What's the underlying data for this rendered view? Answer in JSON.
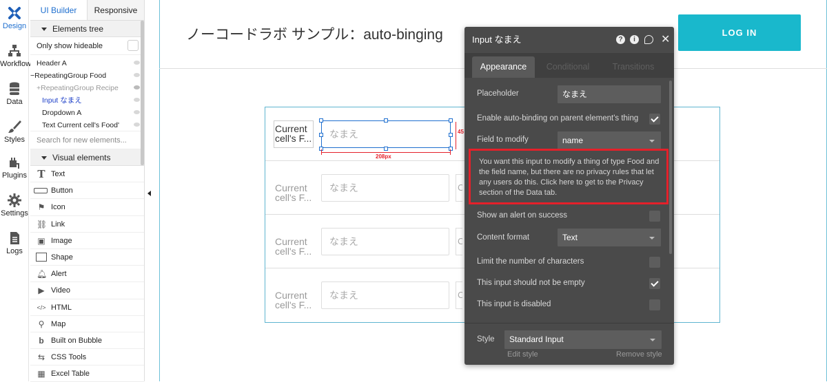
{
  "nav": [
    {
      "label": "Design",
      "icon": "design-icon",
      "active": true
    },
    {
      "label": "Workflow",
      "icon": "workflow-icon"
    },
    {
      "label": "Data",
      "icon": "data-icon"
    },
    {
      "label": "Styles",
      "icon": "styles-icon"
    },
    {
      "label": "Plugins",
      "icon": "plugins-icon"
    },
    {
      "label": "Settings",
      "icon": "settings-icon"
    },
    {
      "label": "Logs",
      "icon": "logs-icon"
    }
  ],
  "panel": {
    "tab_ui_builder": "UI Builder",
    "tab_responsive": "Responsive",
    "elements_tree": "Elements tree",
    "only_show_hideable": "Only show hideable",
    "tree": [
      {
        "label": "Header A"
      },
      {
        "label": "RepeatingGroup Food",
        "prefix": "−"
      },
      {
        "label": "RepeatingGroup Recipe",
        "prefix": "+"
      },
      {
        "label": "Input なまえ"
      },
      {
        "label": "Dropdown A"
      },
      {
        "label": "Text Current cell's Food'"
      }
    ],
    "search_placeholder": "Search for new elements...",
    "visual_elements": "Visual elements",
    "visual_items": [
      {
        "label": "Text",
        "icon": "text-icon"
      },
      {
        "label": "Button",
        "icon": "button-icon"
      },
      {
        "label": "Icon",
        "icon": "icon-icon"
      },
      {
        "label": "Link",
        "icon": "link-icon"
      },
      {
        "label": "Image",
        "icon": "image-icon"
      },
      {
        "label": "Shape",
        "icon": "shape-icon"
      },
      {
        "label": "Alert",
        "icon": "alert-icon"
      },
      {
        "label": "Video",
        "icon": "video-icon"
      },
      {
        "label": "HTML",
        "icon": "html-icon"
      },
      {
        "label": "Map",
        "icon": "map-icon"
      },
      {
        "label": "Built on Bubble",
        "icon": "bubble-icon"
      },
      {
        "label": "CSS Tools",
        "icon": "css-tools-icon"
      },
      {
        "label": "Excel Table",
        "icon": "excel-icon"
      }
    ]
  },
  "canvas": {
    "title": "ノーコードラボ サンプル：auto-binging",
    "login": "LOG IN",
    "cell_text": "Current cell's F...",
    "cell_text_line1": "Current",
    "cell_text_line2": "cell's F...",
    "input_placeholder": "なまえ",
    "cut_char": "C",
    "width_label": "208px",
    "offset_label": "45"
  },
  "editor": {
    "title": "Input なまえ",
    "tabs": [
      "Appearance",
      "Conditional",
      "Transitions"
    ],
    "placeholder_label": "Placeholder",
    "placeholder_value": "なまえ",
    "auto_binding_label": "Enable auto-binding on parent element's thing",
    "field_label": "Field to modify",
    "field_value": "name",
    "warning": "You want this input to modify a thing of type Food and the field name, but there are no privacy rules that let any users do this. Click here to get to the Privacy section of the Data tab.",
    "alert_label": "Show an alert on success",
    "content_format_label": "Content format",
    "content_format_value": "Text",
    "limit_label": "Limit the number of characters",
    "not_empty_label": "This input should not be empty",
    "disabled_label": "This input is disabled",
    "style_label": "Style",
    "style_value": "Standard Input",
    "edit_style": "Edit style",
    "remove_style": "Remove style"
  },
  "colors": {
    "accent": "#1e6fcf",
    "login": "#19b8cc",
    "warning_border": "#e5202a",
    "editor_bg": "#4a4a4a"
  }
}
